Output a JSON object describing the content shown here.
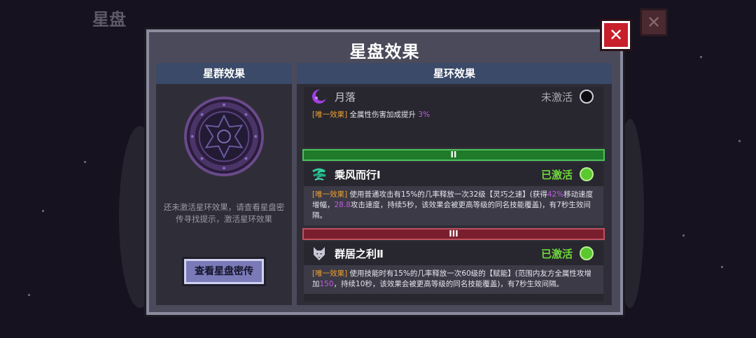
{
  "background": {
    "title": "星盘",
    "close_glyph": "✕"
  },
  "modal": {
    "title": "星盘效果",
    "close_glyph": "✕"
  },
  "left_panel": {
    "header": "星群效果",
    "hint": "还未激活星环效果，请查看星盘密传寻找提示，激活星环效果",
    "button_label": "查看星盘密传"
  },
  "right_panel": {
    "header": "星环效果",
    "effects": [
      {
        "icon": "crescent-moon-icon",
        "name": "月落",
        "status": "未激活",
        "active": false,
        "tag": "[唯一效果]",
        "desc_before": "全属性伤害加成提升",
        "highlight1": "3%",
        "desc_middle": "",
        "highlight2": "",
        "desc_after": ""
      },
      {
        "tier": "II",
        "icon": "wind-icon",
        "name": "乘风而行Ⅰ",
        "status": "已激活",
        "active": true,
        "tag": "[唯一效果]",
        "desc_before": "使用普通攻击有15%的几率释放一次32级【灵巧之速】(获得",
        "highlight1": "42%",
        "desc_middle": "移动速度增幅，",
        "highlight2": "28.8",
        "desc_after": "攻击速度，持续5秒，该效果会被更高等级的同名技能覆盖)，有7秒生效间隔。"
      },
      {
        "tier": "III",
        "icon": "wolf-icon",
        "name": "群居之利Ⅱ",
        "status": "已激活",
        "active": true,
        "tag": "[唯一效果]",
        "desc_before": "使用技能时有15%的几率释放一次60级的【赋能】(范围内友方全属性攻增加",
        "highlight1": "150",
        "desc_middle": "，持续10秒，该效果会被更高等级的同名技能覆盖)，有7秒生效间隔。",
        "highlight2": "",
        "desc_after": ""
      }
    ]
  },
  "colors": {
    "active_status": "#6ed83a",
    "inactive_status": "#a8a8b4",
    "tier2": "#2a8a2a",
    "tier3": "#8a2a3a",
    "tag": "#f0a030",
    "highlight": "#c05ae0"
  }
}
